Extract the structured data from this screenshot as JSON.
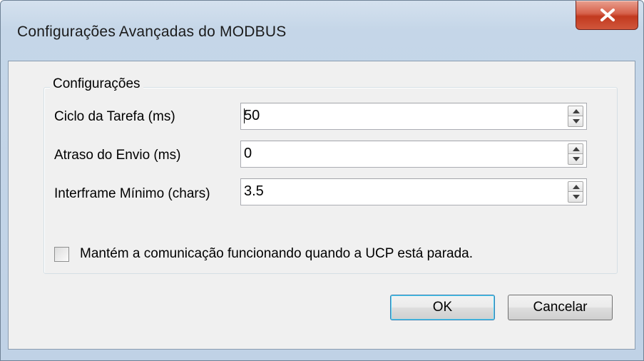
{
  "window": {
    "title": "Configurações Avançadas do MODBUS"
  },
  "group": {
    "legend": "Configurações"
  },
  "fields": [
    {
      "label": "Ciclo da Tarefa (ms)",
      "value": "50"
    },
    {
      "label": "Atraso do Envio (ms)",
      "value": "0"
    },
    {
      "label": "Interframe Mínimo (chars)",
      "value": "3.5"
    }
  ],
  "checkbox": {
    "label": "Mantém a comunicação funcionando quando a UCP está parada.",
    "checked": false
  },
  "buttons": {
    "ok": "OK",
    "cancel": "Cancelar"
  },
  "icons": {
    "close": "close-icon",
    "spin_up": "arrow-up-icon",
    "spin_down": "arrow-down-icon"
  }
}
